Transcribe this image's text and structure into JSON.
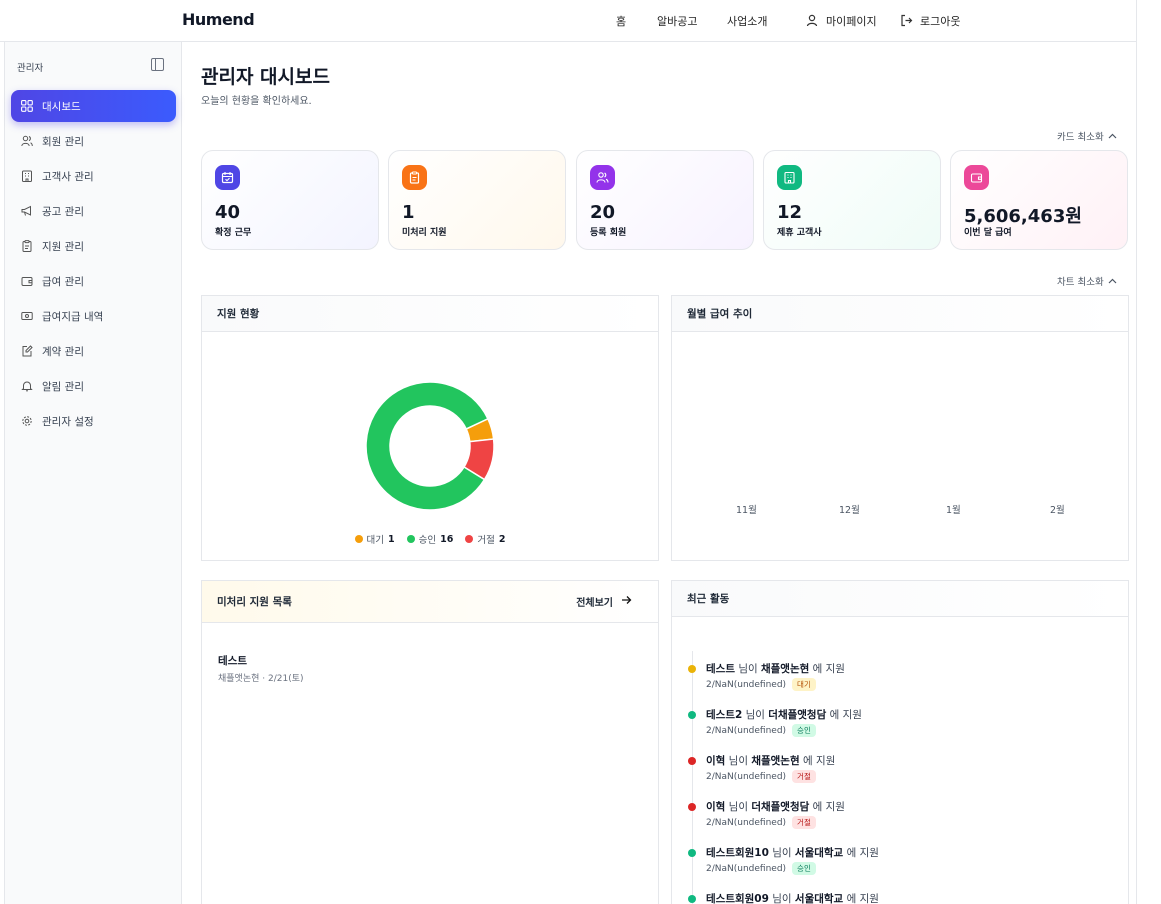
{
  "app": {
    "logo": "Humend"
  },
  "topnav": {
    "home": "홈",
    "jobs": "알바공고",
    "about": "사업소개",
    "mypage": "마이페이지",
    "logout": "로그아웃"
  },
  "sidebar": {
    "header": "관리자",
    "items": [
      {
        "label": "대시보드",
        "icon": "dashboard-icon",
        "active": true
      },
      {
        "label": "회원 관리",
        "icon": "users-icon"
      },
      {
        "label": "고객사 관리",
        "icon": "building-icon"
      },
      {
        "label": "공고 관리",
        "icon": "megaphone-icon"
      },
      {
        "label": "지원 관리",
        "icon": "clipboard-icon"
      },
      {
        "label": "급여 관리",
        "icon": "wallet-icon"
      },
      {
        "label": "급여지급 내역",
        "icon": "cash-icon"
      },
      {
        "label": "계약 관리",
        "icon": "edit-document-icon"
      },
      {
        "label": "알림 관리",
        "icon": "bell-icon"
      },
      {
        "label": "관리자 설정",
        "icon": "gear-icon"
      }
    ]
  },
  "page": {
    "title": "관리자 대시보드",
    "subtitle": "오늘의 현황을 확인하세요."
  },
  "controls": {
    "card_minimize": "카드 최소화",
    "chart_minimize": "차트 최소화"
  },
  "stats": [
    {
      "value": "40",
      "label": "확정 근무",
      "color": "#4f46e5",
      "icon": "calendar-check-icon"
    },
    {
      "value": "1",
      "label": "미처리 지원",
      "color": "#f97316",
      "icon": "clipboard-icon"
    },
    {
      "value": "20",
      "label": "등록 회원",
      "color": "#9333ea",
      "icon": "users-icon"
    },
    {
      "value": "12",
      "label": "제휴 고객사",
      "color": "#10b981",
      "icon": "building-icon"
    },
    {
      "value": "5,606,463원",
      "label": "이번 달 급여",
      "color": "#ec4899",
      "icon": "wallet-icon"
    }
  ],
  "panels": {
    "applications": "지원 현황",
    "monthly_pay": "월별 급여 추이",
    "pending": "미처리 지원 목록",
    "view_all": "전체보기",
    "recent": "최근 활동"
  },
  "chart_data": [
    {
      "type": "pie",
      "title": "지원 현황",
      "categories": [
        "대기",
        "승인",
        "거절"
      ],
      "values": [
        1,
        16,
        2
      ],
      "colors": [
        "#f59e0b",
        "#22c55e",
        "#ef4444"
      ],
      "donut": true,
      "legend": "bottom"
    },
    {
      "type": "line",
      "title": "월별 급여 추이",
      "categories": [
        "11월",
        "12월",
        "1월",
        "2월"
      ],
      "series": []
    }
  ],
  "legend_counts": [
    "1",
    "16",
    "2"
  ],
  "pending_list": [
    {
      "name": "테스트",
      "detail": "채플앳논현 · 2/21(토)"
    }
  ],
  "activities": [
    {
      "name": "테스트",
      "mid": " 님이 ",
      "place": "채플앳논현",
      "end": " 에 지원",
      "date": "2/NaN(undefined)",
      "status": "대기",
      "color": "#eab308",
      "badge_bg": "#fef3c7",
      "badge_fg": "#b45309"
    },
    {
      "name": "테스트2",
      "mid": " 님이 ",
      "place": "더채플앳청담",
      "end": " 에 지원",
      "date": "2/NaN(undefined)",
      "status": "승인",
      "color": "#10b981",
      "badge_bg": "#d1fae5",
      "badge_fg": "#047857"
    },
    {
      "name": "이혁",
      "mid": " 님이 ",
      "place": "채플앳논현",
      "end": " 에 지원",
      "date": "2/NaN(undefined)",
      "status": "거절",
      "color": "#dc2626",
      "badge_bg": "#fee2e2",
      "badge_fg": "#b91c1c"
    },
    {
      "name": "이혁",
      "mid": " 님이 ",
      "place": "더채플앳청담",
      "end": " 에 지원",
      "date": "2/NaN(undefined)",
      "status": "거절",
      "color": "#dc2626",
      "badge_bg": "#fee2e2",
      "badge_fg": "#b91c1c"
    },
    {
      "name": "테스트회원10",
      "mid": " 님이 ",
      "place": "서울대학교",
      "end": " 에 지원",
      "date": "2/NaN(undefined)",
      "status": "승인",
      "color": "#10b981",
      "badge_bg": "#d1fae5",
      "badge_fg": "#047857"
    },
    {
      "name": "테스트회원09",
      "mid": " 님이 ",
      "place": "서울대학교",
      "end": " 에 지원",
      "date": "",
      "status": "",
      "color": "#10b981",
      "badge_bg": "#d1fae5",
      "badge_fg": "#047857"
    }
  ]
}
